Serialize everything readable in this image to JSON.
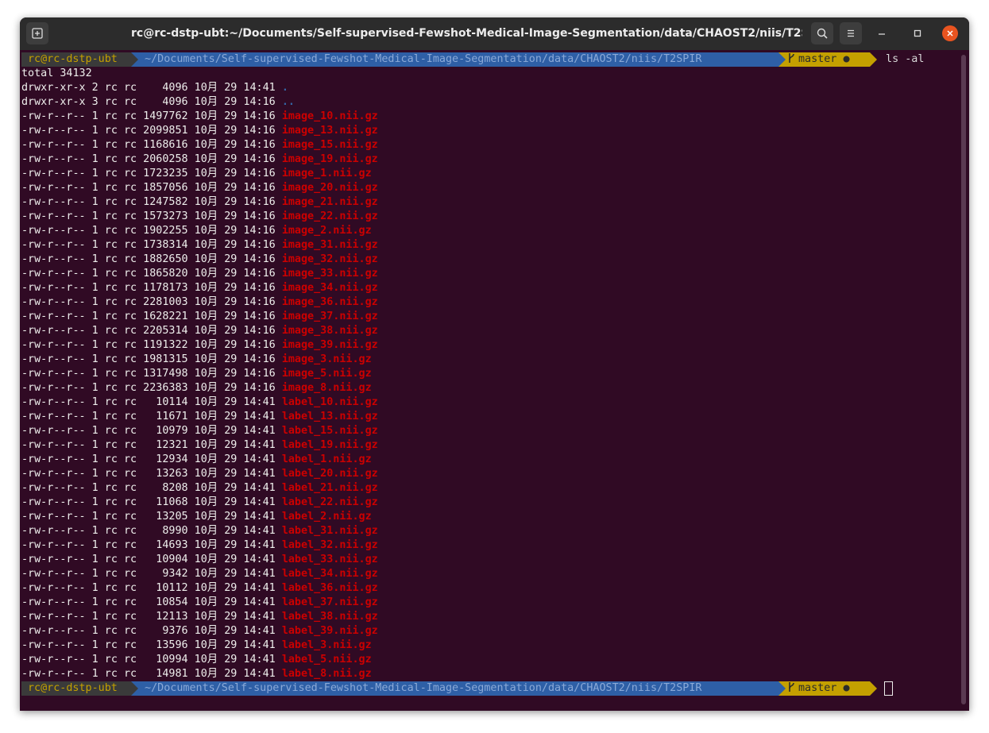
{
  "window": {
    "title": "rc@rc-dstp-ubt:~/Documents/Self-supervised-Fewshot-Medical-Image-Segmentation/data/CHAOST2/niis/T2SPIR",
    "buttons": [
      "new-tab-icon",
      "search-icon",
      "hamburger-menu-icon",
      "minimize-icon",
      "maximize-icon",
      "close-icon"
    ]
  },
  "prompt": {
    "user": "rc@rc-dstp-ubt",
    "path": "~/Documents/Self-supervised-Fewshot-Medical-Image-Segmentation/data/CHAOST2/niis/T2SPIR",
    "branch_icon": "git-branch-icon",
    "branch": "master",
    "command": "ls -al"
  },
  "total": "total 34132",
  "listing": [
    {
      "meta": "drwxr-xr-x 2 rc rc    4096 10月 29 14:41 ",
      "name": ".",
      "kind": "dir"
    },
    {
      "meta": "drwxr-xr-x 3 rc rc    4096 10月 29 14:16 ",
      "name": "..",
      "kind": "dir"
    },
    {
      "meta": "-rw-r--r-- 1 rc rc 1497762 10月 29 14:16 ",
      "name": "image_10.nii.gz",
      "kind": "file"
    },
    {
      "meta": "-rw-r--r-- 1 rc rc 2099851 10月 29 14:16 ",
      "name": "image_13.nii.gz",
      "kind": "file"
    },
    {
      "meta": "-rw-r--r-- 1 rc rc 1168616 10月 29 14:16 ",
      "name": "image_15.nii.gz",
      "kind": "file"
    },
    {
      "meta": "-rw-r--r-- 1 rc rc 2060258 10月 29 14:16 ",
      "name": "image_19.nii.gz",
      "kind": "file"
    },
    {
      "meta": "-rw-r--r-- 1 rc rc 1723235 10月 29 14:16 ",
      "name": "image_1.nii.gz",
      "kind": "file"
    },
    {
      "meta": "-rw-r--r-- 1 rc rc 1857056 10月 29 14:16 ",
      "name": "image_20.nii.gz",
      "kind": "file"
    },
    {
      "meta": "-rw-r--r-- 1 rc rc 1247582 10月 29 14:16 ",
      "name": "image_21.nii.gz",
      "kind": "file"
    },
    {
      "meta": "-rw-r--r-- 1 rc rc 1573273 10月 29 14:16 ",
      "name": "image_22.nii.gz",
      "kind": "file"
    },
    {
      "meta": "-rw-r--r-- 1 rc rc 1902255 10月 29 14:16 ",
      "name": "image_2.nii.gz",
      "kind": "file"
    },
    {
      "meta": "-rw-r--r-- 1 rc rc 1738314 10月 29 14:16 ",
      "name": "image_31.nii.gz",
      "kind": "file"
    },
    {
      "meta": "-rw-r--r-- 1 rc rc 1882650 10月 29 14:16 ",
      "name": "image_32.nii.gz",
      "kind": "file"
    },
    {
      "meta": "-rw-r--r-- 1 rc rc 1865820 10月 29 14:16 ",
      "name": "image_33.nii.gz",
      "kind": "file"
    },
    {
      "meta": "-rw-r--r-- 1 rc rc 1178173 10月 29 14:16 ",
      "name": "image_34.nii.gz",
      "kind": "file"
    },
    {
      "meta": "-rw-r--r-- 1 rc rc 2281003 10月 29 14:16 ",
      "name": "image_36.nii.gz",
      "kind": "file"
    },
    {
      "meta": "-rw-r--r-- 1 rc rc 1628221 10月 29 14:16 ",
      "name": "image_37.nii.gz",
      "kind": "file"
    },
    {
      "meta": "-rw-r--r-- 1 rc rc 2205314 10月 29 14:16 ",
      "name": "image_38.nii.gz",
      "kind": "file"
    },
    {
      "meta": "-rw-r--r-- 1 rc rc 1191322 10月 29 14:16 ",
      "name": "image_39.nii.gz",
      "kind": "file"
    },
    {
      "meta": "-rw-r--r-- 1 rc rc 1981315 10月 29 14:16 ",
      "name": "image_3.nii.gz",
      "kind": "file"
    },
    {
      "meta": "-rw-r--r-- 1 rc rc 1317498 10月 29 14:16 ",
      "name": "image_5.nii.gz",
      "kind": "file"
    },
    {
      "meta": "-rw-r--r-- 1 rc rc 2236383 10月 29 14:16 ",
      "name": "image_8.nii.gz",
      "kind": "file"
    },
    {
      "meta": "-rw-r--r-- 1 rc rc   10114 10月 29 14:41 ",
      "name": "label_10.nii.gz",
      "kind": "file"
    },
    {
      "meta": "-rw-r--r-- 1 rc rc   11671 10月 29 14:41 ",
      "name": "label_13.nii.gz",
      "kind": "file"
    },
    {
      "meta": "-rw-r--r-- 1 rc rc   10979 10月 29 14:41 ",
      "name": "label_15.nii.gz",
      "kind": "file"
    },
    {
      "meta": "-rw-r--r-- 1 rc rc   12321 10月 29 14:41 ",
      "name": "label_19.nii.gz",
      "kind": "file"
    },
    {
      "meta": "-rw-r--r-- 1 rc rc   12934 10月 29 14:41 ",
      "name": "label_1.nii.gz",
      "kind": "file"
    },
    {
      "meta": "-rw-r--r-- 1 rc rc   13263 10月 29 14:41 ",
      "name": "label_20.nii.gz",
      "kind": "file"
    },
    {
      "meta": "-rw-r--r-- 1 rc rc    8208 10月 29 14:41 ",
      "name": "label_21.nii.gz",
      "kind": "file"
    },
    {
      "meta": "-rw-r--r-- 1 rc rc   11068 10月 29 14:41 ",
      "name": "label_22.nii.gz",
      "kind": "file"
    },
    {
      "meta": "-rw-r--r-- 1 rc rc   13205 10月 29 14:41 ",
      "name": "label_2.nii.gz",
      "kind": "file"
    },
    {
      "meta": "-rw-r--r-- 1 rc rc    8990 10月 29 14:41 ",
      "name": "label_31.nii.gz",
      "kind": "file"
    },
    {
      "meta": "-rw-r--r-- 1 rc rc   14693 10月 29 14:41 ",
      "name": "label_32.nii.gz",
      "kind": "file"
    },
    {
      "meta": "-rw-r--r-- 1 rc rc   10904 10月 29 14:41 ",
      "name": "label_33.nii.gz",
      "kind": "file"
    },
    {
      "meta": "-rw-r--r-- 1 rc rc    9342 10月 29 14:41 ",
      "name": "label_34.nii.gz",
      "kind": "file"
    },
    {
      "meta": "-rw-r--r-- 1 rc rc   10112 10月 29 14:41 ",
      "name": "label_36.nii.gz",
      "kind": "file"
    },
    {
      "meta": "-rw-r--r-- 1 rc rc   10854 10月 29 14:41 ",
      "name": "label_37.nii.gz",
      "kind": "file"
    },
    {
      "meta": "-rw-r--r-- 1 rc rc   12113 10月 29 14:41 ",
      "name": "label_38.nii.gz",
      "kind": "file"
    },
    {
      "meta": "-rw-r--r-- 1 rc rc    9376 10月 29 14:41 ",
      "name": "label_39.nii.gz",
      "kind": "file"
    },
    {
      "meta": "-rw-r--r-- 1 rc rc   13596 10月 29 14:41 ",
      "name": "label_3.nii.gz",
      "kind": "file"
    },
    {
      "meta": "-rw-r--r-- 1 rc rc   10994 10月 29 14:41 ",
      "name": "label_5.nii.gz",
      "kind": "file"
    },
    {
      "meta": "-rw-r--r-- 1 rc rc   14981 10月 29 14:41 ",
      "name": "label_8.nii.gz",
      "kind": "file"
    }
  ],
  "colors": {
    "background": "#300a24",
    "titlebar": "#2c2c2c",
    "file": "#cc0000",
    "dir": "#3465a4",
    "prompt_user_bg": "#3a3a3a",
    "prompt_path_bg": "#2e5fa6",
    "prompt_git_bg": "#c4a000",
    "close_button": "#e95420"
  }
}
